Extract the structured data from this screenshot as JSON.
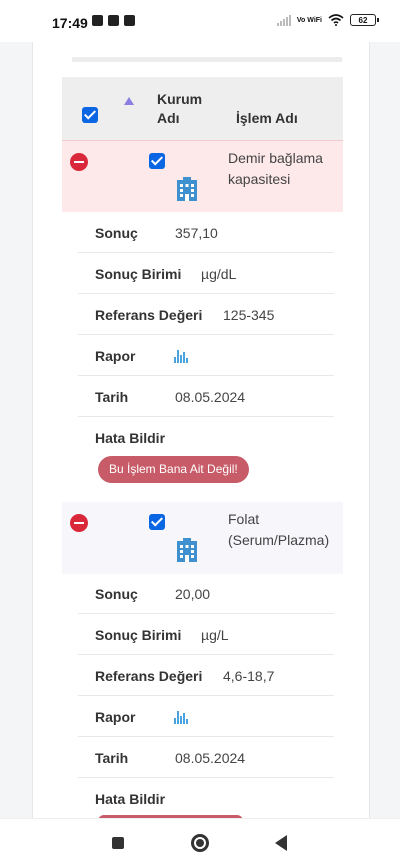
{
  "status_bar": {
    "time": "17:49",
    "network": "Vo WiFi",
    "battery": "62"
  },
  "table": {
    "header": {
      "col_kurum": "Kurum Adı",
      "col_islem": "İşlem Adı"
    },
    "records": [
      {
        "name": "Demir bağlama kapasitesi",
        "details": {
          "sonuc_label": "Sonuç",
          "sonuc_value": "357,10",
          "birim_label": "Sonuç Birimi",
          "birim_value": "µg/dL",
          "referans_label": "Referans Değeri",
          "referans_value": "125-345",
          "rapor_label": "Rapor",
          "tarih_label": "Tarih",
          "tarih_value": "08.05.2024",
          "hata_label": "Hata Bildir",
          "hata_button": "Bu İşlem Bana Ait Değil!"
        }
      },
      {
        "name": "Folat (Serum/Plazma)",
        "details": {
          "sonuc_label": "Sonuç",
          "sonuc_value": "20,00",
          "birim_label": "Sonuç Birimi",
          "birim_value": "µg/L",
          "referans_label": "Referans Değeri",
          "referans_value": "4,6-18,7",
          "rapor_label": "Rapor",
          "tarih_label": "Tarih",
          "tarih_value": "08.05.2024",
          "hata_label": "Hata Bildir"
        }
      }
    ]
  },
  "colors": {
    "accent_checkbox": "#0b66e4",
    "remove": "#d9283a",
    "error_button": "#c75b67",
    "row_highlight": "#fde8ea"
  },
  "icons": {
    "remove": "minus-circle-icon",
    "institution": "building-icon",
    "report": "bar-chart-icon",
    "sort": "sort-ascending-icon"
  }
}
